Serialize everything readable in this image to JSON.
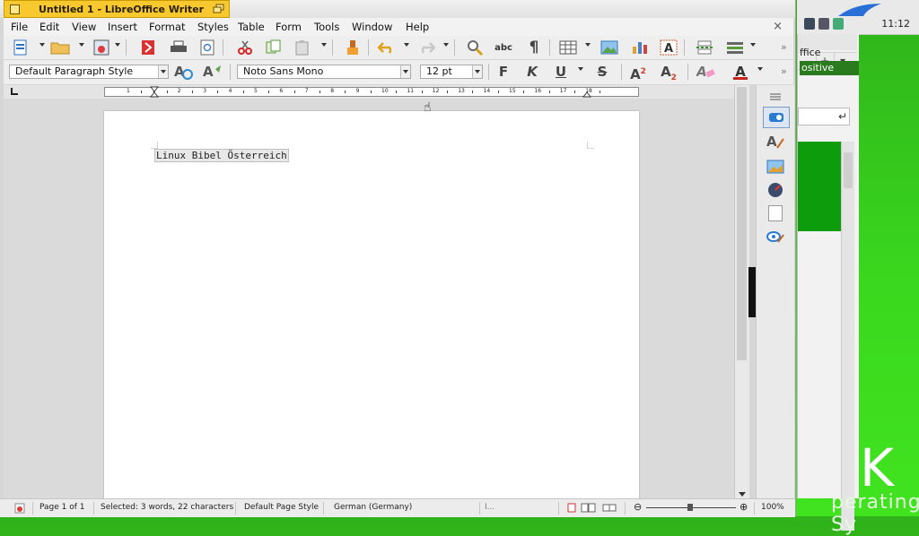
{
  "window": {
    "title": "Untitled 1 - LibreOffice Writer"
  },
  "menubar": {
    "items": [
      "File",
      "Edit",
      "View",
      "Insert",
      "Format",
      "Styles",
      "Table",
      "Form",
      "Tools",
      "Window",
      "Help"
    ],
    "close_glyph": "×"
  },
  "toolbar_standard": {
    "icons": [
      "new-document-icon",
      "open-folder-icon",
      "save-icon",
      "export-pdf-icon",
      "print-icon",
      "print-preview-icon",
      "cut-icon",
      "copy-icon",
      "paste-icon",
      "clone-formatting-icon",
      "undo-icon",
      "redo-icon",
      "find-replace-icon",
      "spellcheck-icon",
      "formatting-marks-icon",
      "insert-table-icon",
      "insert-image-icon",
      "insert-chart-icon",
      "insert-textbox-icon",
      "insert-page-break-icon",
      "insert-field-icon"
    ],
    "spellcheck_label": "abc",
    "formatting_marks_glyph": "¶",
    "overflow_glyph": "»"
  },
  "toolbar_formatting": {
    "paragraph_style": "Default Paragraph Style",
    "font_name": "Noto Sans Mono",
    "font_size": "12 pt",
    "bold_glyph": "F",
    "italic_glyph": "K",
    "underline_glyph": "U",
    "strike_glyph": "S",
    "super_glyph": "A",
    "super_mark": "2",
    "sub_glyph": "A",
    "sub_mark": "2",
    "font_color_glyph": "A",
    "overflow_glyph": "»"
  },
  "ruler": {
    "numbers": [
      "1",
      "1",
      "2",
      "3",
      "4",
      "5",
      "6",
      "7",
      "8",
      "9",
      "10",
      "11",
      "12",
      "13",
      "14",
      "15",
      "16",
      "17",
      "18"
    ]
  },
  "document": {
    "text": "Linux Bibel Österreich"
  },
  "statusbar": {
    "page": "Page 1 of 1",
    "selection": "Selected: 3 words, 22 characters",
    "page_style": "Default Page Style",
    "language": "German (Germany)",
    "insert_mode": "I...",
    "zoom": "100%",
    "zoom_minus": "⊖",
    "zoom_plus": "⊕"
  },
  "desktop": {
    "clock": "11:12",
    "bg_app_text_1": "ffice",
    "bg_app_text_2": "ositive",
    "bg_buttons": [
      "+",
      "▾"
    ],
    "bg_enter_glyph": "↵",
    "logo_letter": "K",
    "os_text": "perating Sy"
  },
  "colors": {
    "title_tab": "#f7c92f",
    "desktop_green": "#3ad81e",
    "sidebar_dark_green": "#0c9c0c"
  }
}
